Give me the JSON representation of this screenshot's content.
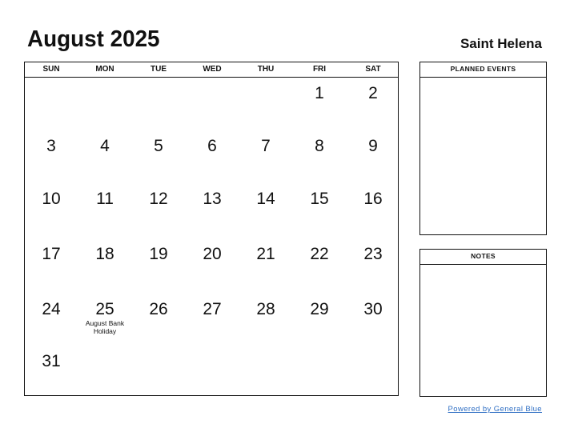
{
  "header": {
    "title": "August 2025",
    "country": "Saint Helena"
  },
  "calendar": {
    "weekdays": [
      "SUN",
      "MON",
      "TUE",
      "WED",
      "THU",
      "FRI",
      "SAT"
    ],
    "weeks": [
      [
        null,
        null,
        null,
        null,
        null,
        {
          "day": "1"
        },
        {
          "day": "2"
        }
      ],
      [
        {
          "day": "3"
        },
        {
          "day": "4"
        },
        {
          "day": "5"
        },
        {
          "day": "6"
        },
        {
          "day": "7"
        },
        {
          "day": "8"
        },
        {
          "day": "9"
        }
      ],
      [
        {
          "day": "10"
        },
        {
          "day": "11"
        },
        {
          "day": "12"
        },
        {
          "day": "13"
        },
        {
          "day": "14"
        },
        {
          "day": "15"
        },
        {
          "day": "16"
        }
      ],
      [
        {
          "day": "17"
        },
        {
          "day": "18"
        },
        {
          "day": "19"
        },
        {
          "day": "20"
        },
        {
          "day": "21"
        },
        {
          "day": "22"
        },
        {
          "day": "23"
        }
      ],
      [
        {
          "day": "24"
        },
        {
          "day": "25",
          "holiday": "August Bank Holiday"
        },
        {
          "day": "26"
        },
        {
          "day": "27"
        },
        {
          "day": "28"
        },
        {
          "day": "29"
        },
        {
          "day": "30"
        }
      ],
      [
        {
          "day": "31"
        },
        null,
        null,
        null,
        null,
        null,
        null
      ]
    ]
  },
  "panels": {
    "planned_events": "PLANNED EVENTS",
    "notes": "NOTES"
  },
  "footer": {
    "powered_by": "Powered by General Blue"
  }
}
